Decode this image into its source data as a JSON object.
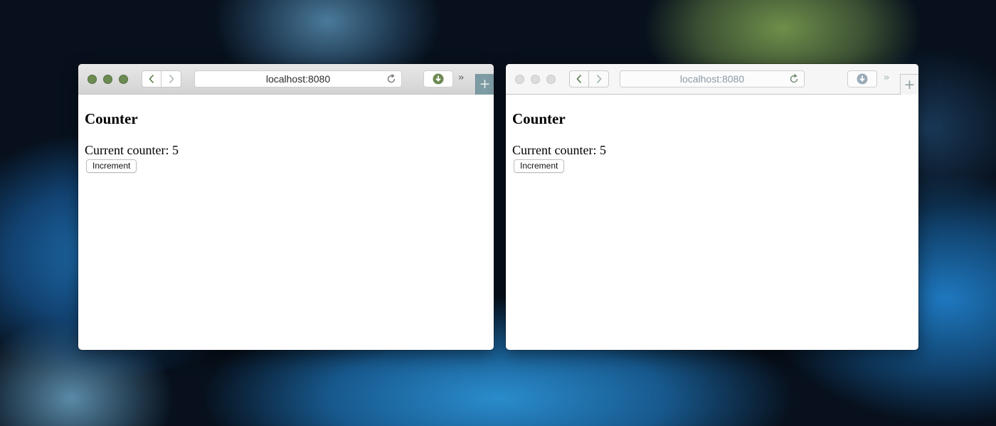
{
  "windows": [
    {
      "state": "active",
      "url": "localhost:8080",
      "page": {
        "heading": "Counter",
        "counter_label": "Current counter:",
        "counter_value": "5",
        "button_label": "Increment"
      },
      "toolbar": {
        "overflow_label": "››",
        "new_tab_label": "+"
      }
    },
    {
      "state": "inactive",
      "url": "localhost:8080",
      "page": {
        "heading": "Counter",
        "counter_label": "Current counter:",
        "counter_value": "5",
        "button_label": "Increment"
      },
      "toolbar": {
        "overflow_label": "››",
        "new_tab_label": "+"
      }
    }
  ],
  "icons": {
    "close": "close-icon",
    "minimize": "minimize-icon",
    "zoom": "zoom-icon",
    "back": "chevron-left-icon",
    "forward": "chevron-right-icon",
    "reload": "reload-icon",
    "download": "download-icon",
    "overflow": "chevron-double-right-icon",
    "new_tab": "plus-icon"
  },
  "colors": {
    "active_traffic_light": "#6c8a52",
    "inactive_traffic_light": "#dcdcdc",
    "download_icon": "#6c8a52",
    "new_tab_active": "#7d9ba3"
  }
}
